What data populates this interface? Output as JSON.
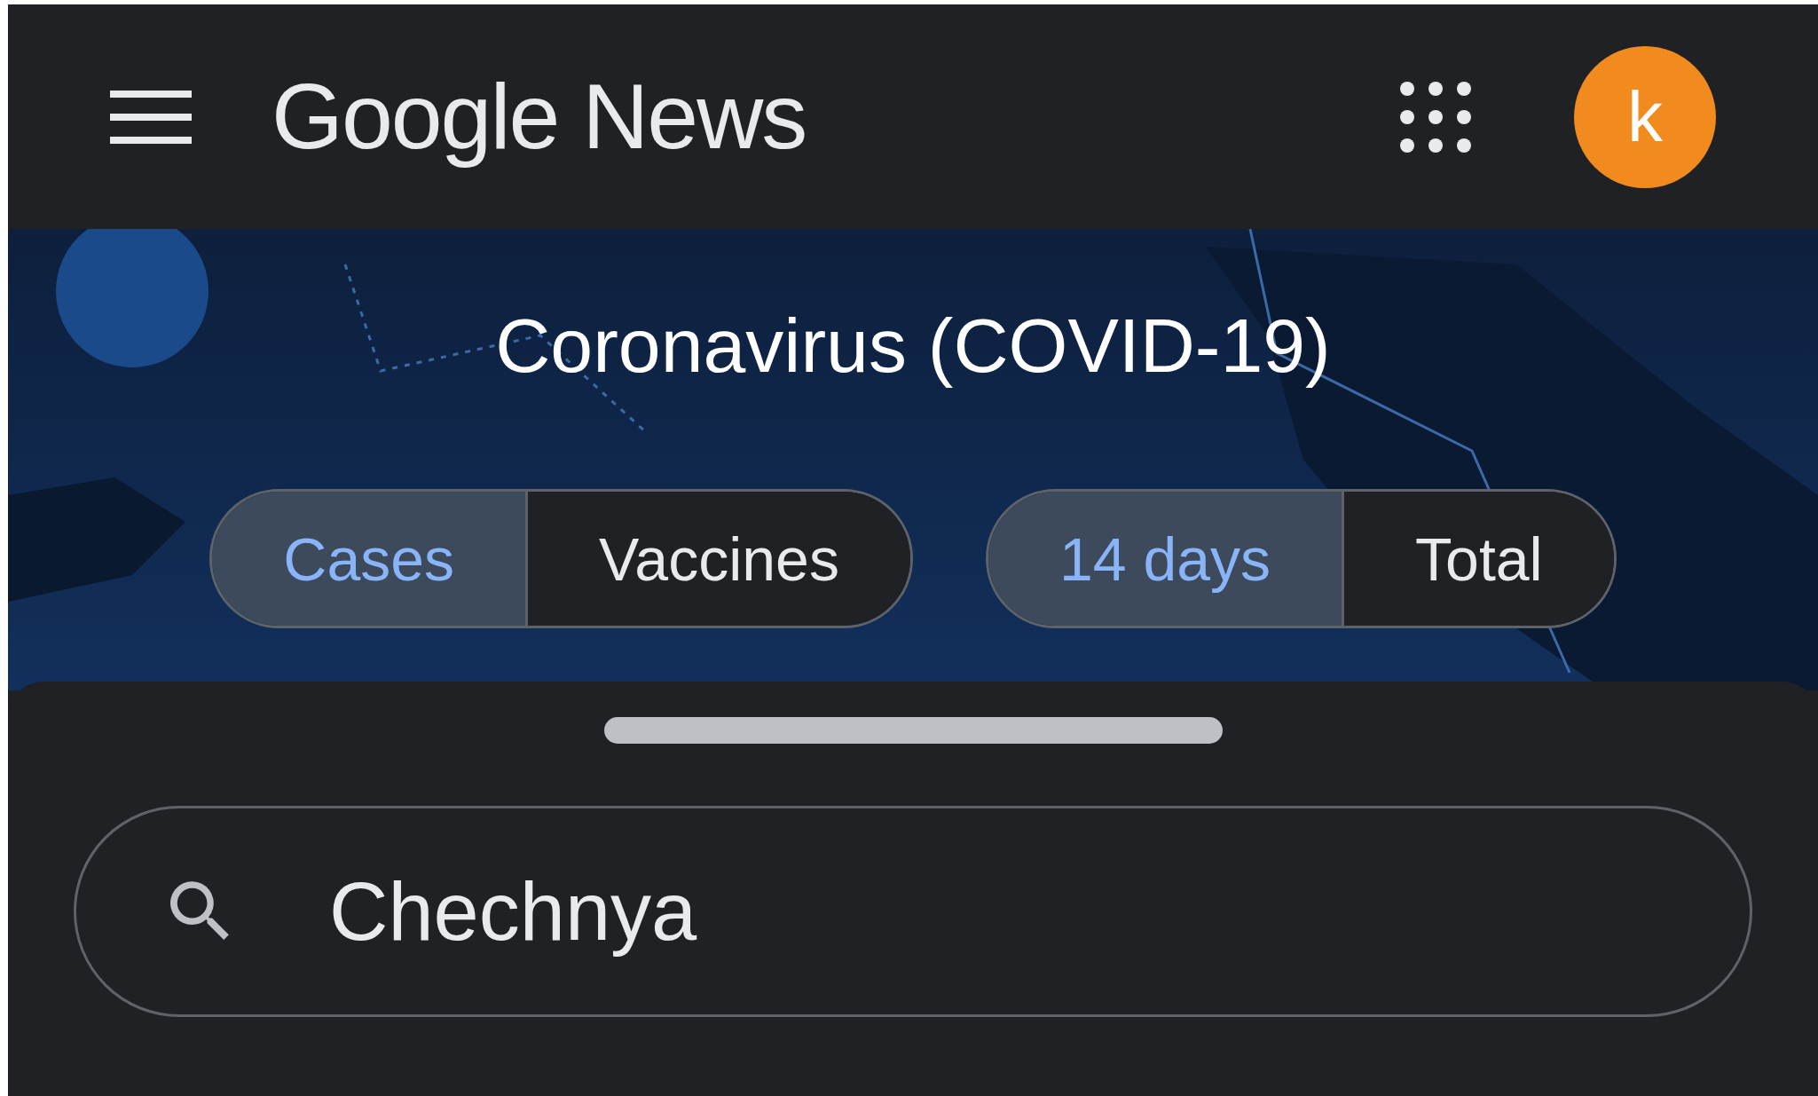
{
  "header": {
    "title": "Google News",
    "avatar_letter": "k"
  },
  "banner": {
    "title": "Coronavirus (COVID-19)",
    "toggle_groups": [
      [
        {
          "label": "Cases",
          "selected": true
        },
        {
          "label": "Vaccines",
          "selected": false
        }
      ],
      [
        {
          "label": "14 days",
          "selected": true
        },
        {
          "label": "Total",
          "selected": false
        }
      ]
    ]
  },
  "search": {
    "value": "Chechnya"
  }
}
